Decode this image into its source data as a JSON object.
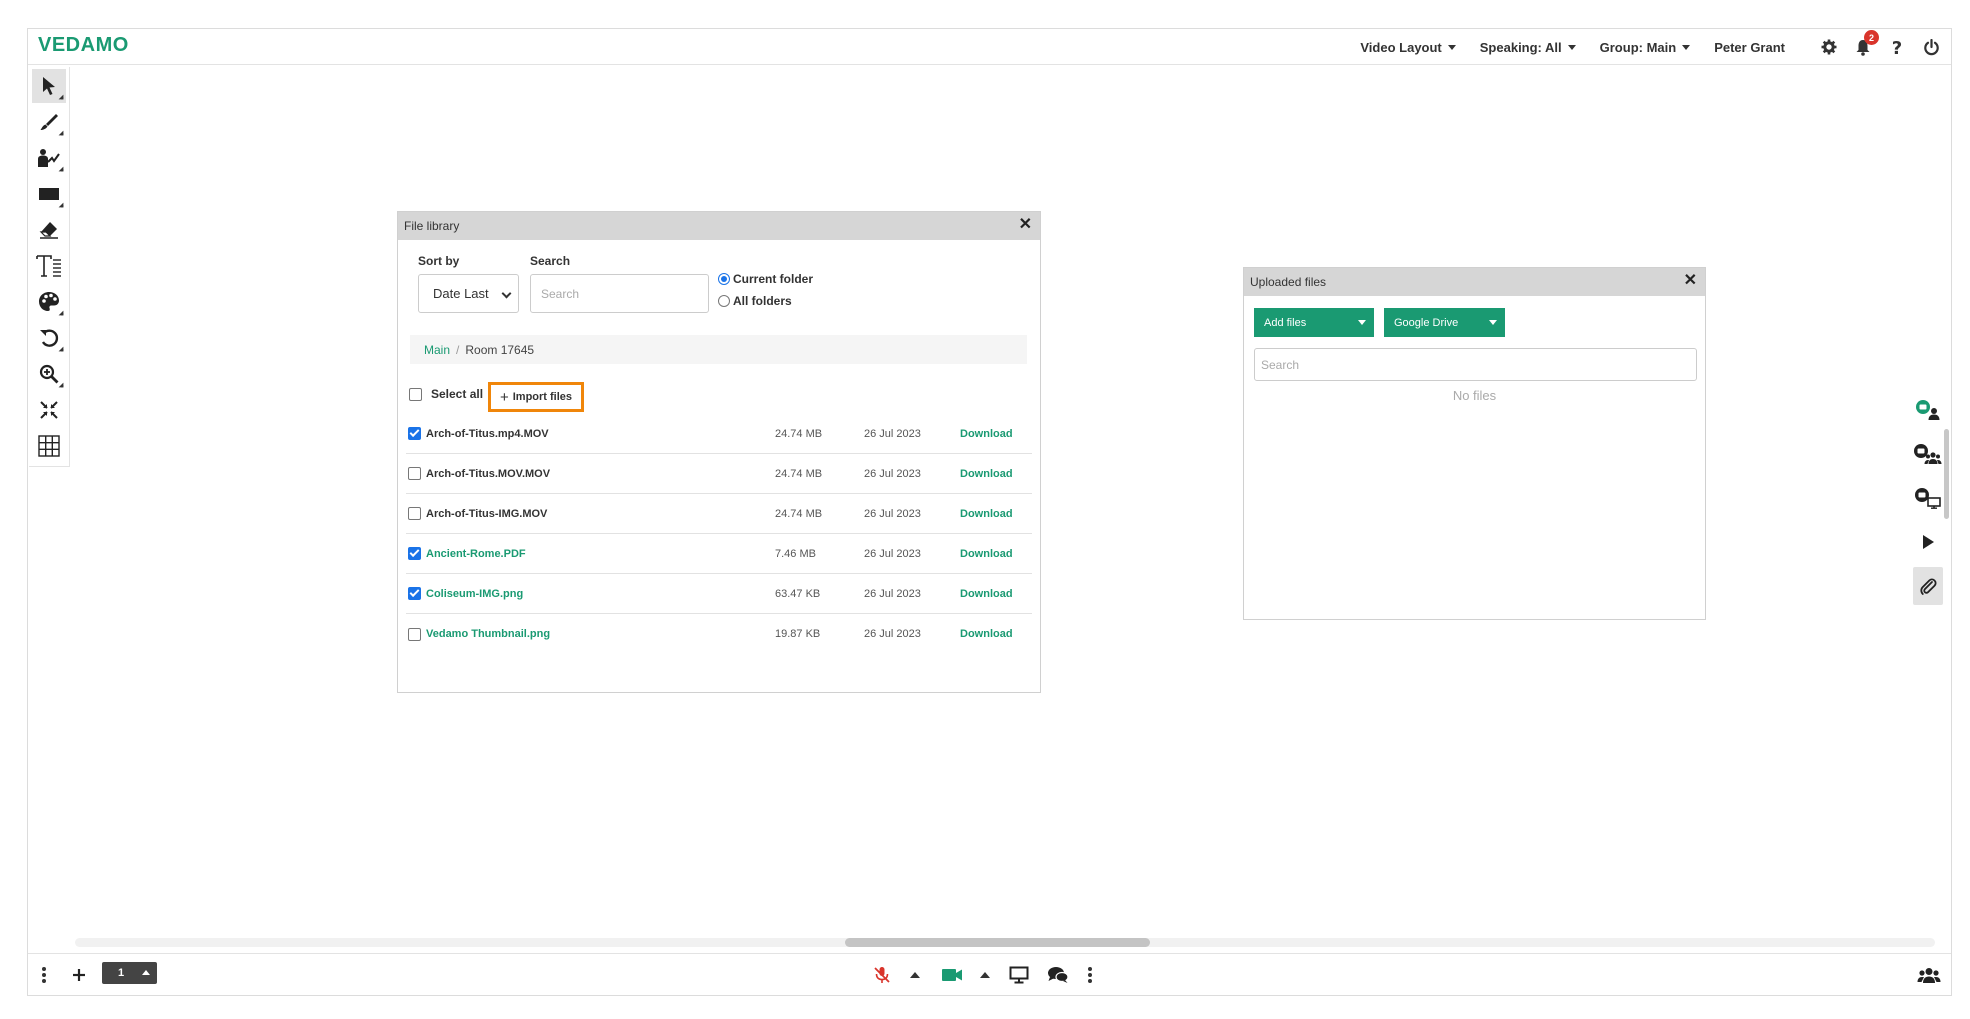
{
  "app": {
    "logo": "VEDAMO",
    "brand_color": "#1a9a72",
    "highlight_color": "#f0860a"
  },
  "topbar": {
    "menus": [
      {
        "label": "Video Layout"
      },
      {
        "label": "Speaking: All"
      },
      {
        "label": "Group: Main"
      }
    ],
    "user_name": "Peter Grant",
    "notification_count": "2",
    "icons": [
      "gear-icon",
      "bell-icon",
      "help-icon",
      "power-icon"
    ]
  },
  "left_toolbar": {
    "tools": [
      "pointer-tool-icon",
      "pen-tool-icon",
      "presenter-tool-icon",
      "shape-tool-icon",
      "eraser-tool-icon",
      "text-tool-icon",
      "palette-tool-icon",
      "undo-tool-icon",
      "zoom-tool-icon",
      "fit-tool-icon",
      "grid-tool-icon"
    ]
  },
  "file_library": {
    "title": "File library",
    "sort_label": "Sort by",
    "sort_value": "Date Last",
    "search_label": "Search",
    "search_placeholder": "Search",
    "radio_current": "Current folder",
    "radio_all": "All folders",
    "breadcrumb": {
      "root": "Main",
      "separator": "/",
      "current": "Room 17645"
    },
    "select_all_label": "Select all",
    "import_label": "Import files",
    "files": [
      {
        "name": "Arch-of-Titus.mp4.MOV",
        "size": "24.74 MB",
        "date": "26 Jul 2023",
        "action": "Download",
        "checked": true,
        "green": false
      },
      {
        "name": "Arch-of-Titus.MOV.MOV",
        "size": "24.74 MB",
        "date": "26 Jul 2023",
        "action": "Download",
        "checked": false,
        "green": false
      },
      {
        "name": "Arch-of-Titus-IMG.MOV",
        "size": "24.74 MB",
        "date": "26 Jul 2023",
        "action": "Download",
        "checked": false,
        "green": false
      },
      {
        "name": "Ancient-Rome.PDF",
        "size": "7.46 MB",
        "date": "26 Jul 2023",
        "action": "Download",
        "checked": true,
        "green": true
      },
      {
        "name": "Coliseum-IMG.png",
        "size": "63.47 KB",
        "date": "26 Jul 2023",
        "action": "Download",
        "checked": true,
        "green": true
      },
      {
        "name": "Vedamo Thumbnail.png",
        "size": "19.87 KB",
        "date": "26 Jul 2023",
        "action": "Download",
        "checked": false,
        "green": true
      }
    ]
  },
  "uploaded_files": {
    "title": "Uploaded files",
    "add_files_label": "Add files",
    "google_drive_label": "Google Drive",
    "search_placeholder": "Search",
    "empty_text": "No files"
  },
  "right_sidebar": {
    "icons": [
      "chat-user-icon",
      "chat-group-icon",
      "chat-screen-icon",
      "play-icon",
      "attachment-icon"
    ]
  },
  "bottombar": {
    "page_number": "1",
    "icons": [
      "more-vertical-icon",
      "add-page-icon",
      "mic-muted-icon",
      "camera-icon",
      "screen-share-icon",
      "chat-icon",
      "more-options-icon",
      "participants-icon"
    ]
  }
}
